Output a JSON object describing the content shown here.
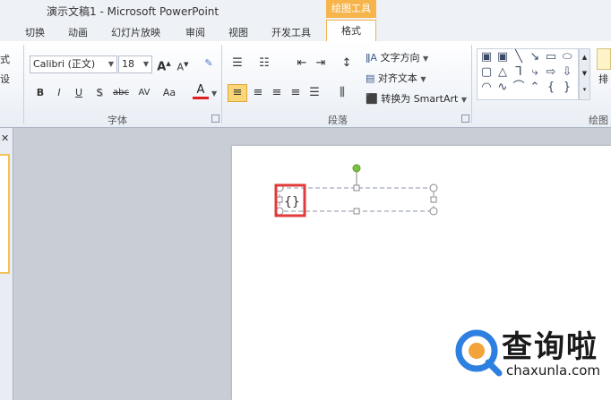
{
  "window": {
    "title": "演示文稿1 - Microsoft PowerPoint",
    "context_group": "绘图工具"
  },
  "tabs": [
    "切换",
    "动画",
    "幻灯片放映",
    "审阅",
    "视图",
    "开发工具"
  ],
  "active_tab": "格式",
  "ribbon": {
    "left_partial": [
      "式",
      "设"
    ],
    "font": {
      "name": "Calibri (正文)",
      "size": "18",
      "group_label": "字体"
    },
    "font_buttons": [
      "B",
      "I",
      "U",
      "S",
      "abc",
      "AV",
      "Aa",
      "A"
    ],
    "paragraph": {
      "group_label": "段落",
      "text_direction": "文字方向",
      "align_text": "对齐文本",
      "convert_smartart": "转换为 SmartArt"
    },
    "drawing": {
      "group_label": "绘图",
      "arrange_partial": "排"
    }
  },
  "icons": {
    "grow": "grow-font-icon",
    "shrink": "shrink-font-icon",
    "clear": "clear-format-icon",
    "bullets": "bullets-icon",
    "numbering": "numbering-icon"
  },
  "watermark": {
    "text_cn": "查询啦",
    "url": "chaxunla.com"
  },
  "colors": {
    "accent": "#f6b44a",
    "font_color": "#e02020",
    "highlight": "#f9d776",
    "selection": "#e23b3b"
  }
}
